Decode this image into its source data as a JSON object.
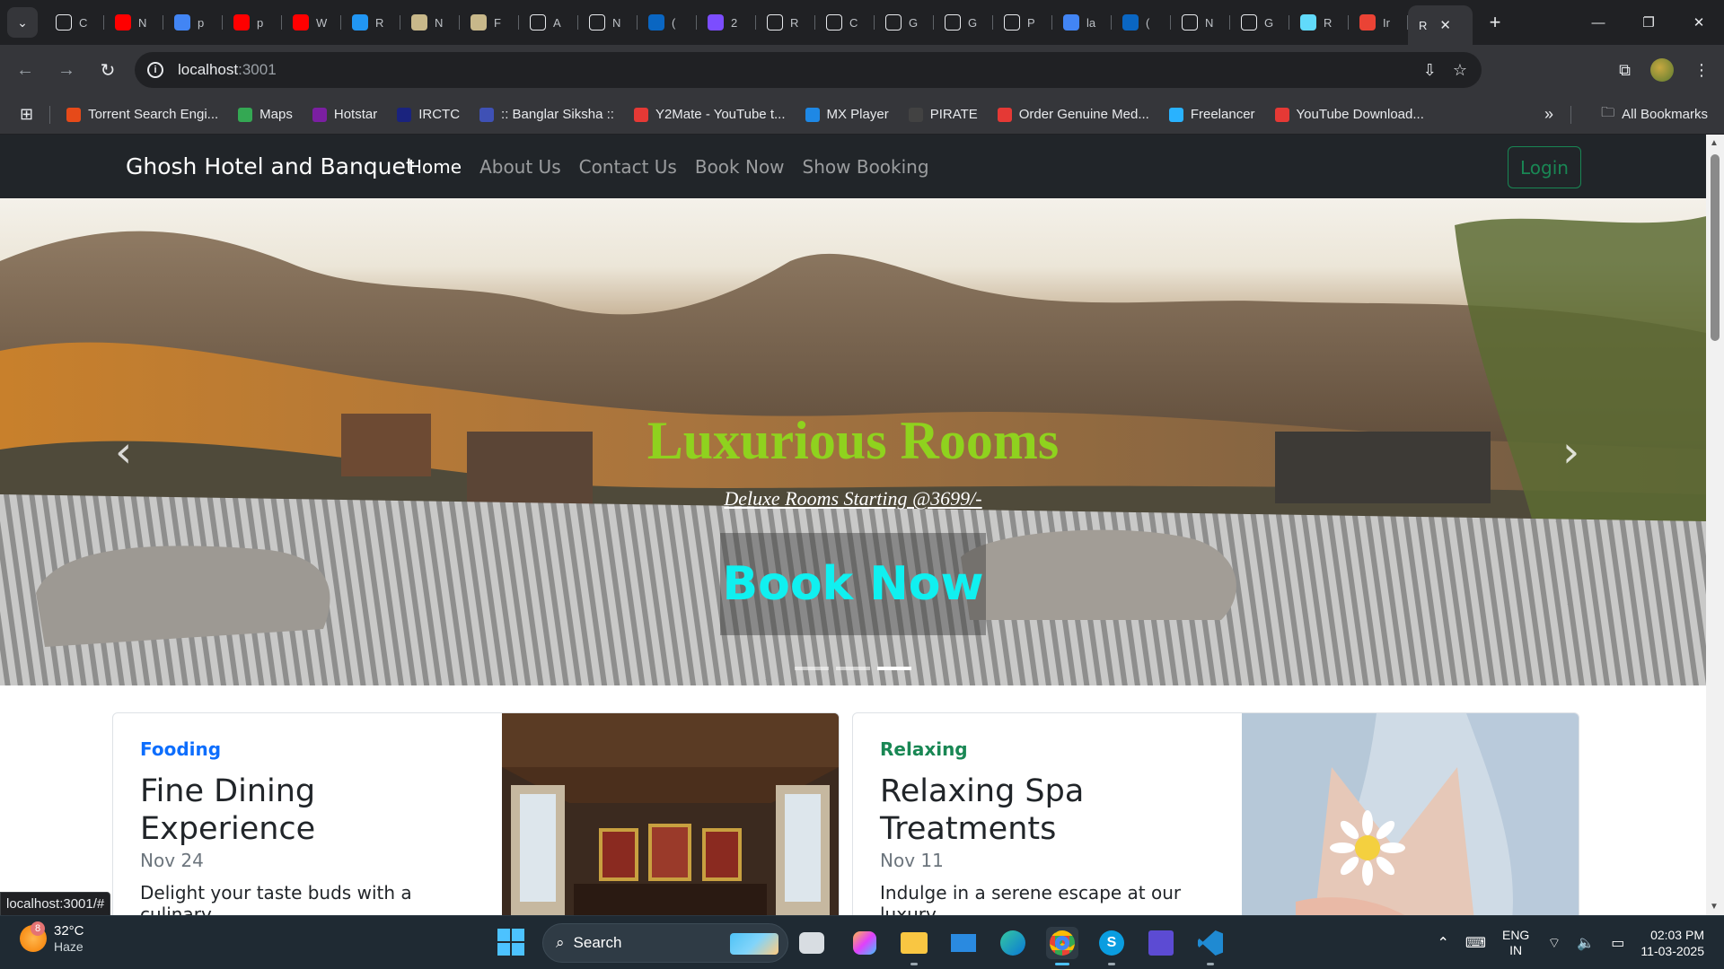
{
  "browser": {
    "tabs": [
      {
        "icon": "triangle-icon",
        "title": "C",
        "color": "#ffffff"
      },
      {
        "icon": "youtube-icon",
        "title": "N",
        "color": "#ff0000"
      },
      {
        "icon": "google-icon",
        "title": "p",
        "color": "#4285f4"
      },
      {
        "icon": "youtube-icon",
        "title": "p",
        "color": "#ff0000"
      },
      {
        "icon": "youtube-icon",
        "title": "W",
        "color": "#ff0000"
      },
      {
        "icon": "react-icon",
        "title": "R",
        "color": "#2196f3"
      },
      {
        "icon": "card-icon",
        "title": "N",
        "color": "#c8b88a"
      },
      {
        "icon": "card-icon",
        "title": "F",
        "color": "#c8b88a"
      },
      {
        "icon": "openai-icon",
        "title": "A",
        "color": "#ffffff"
      },
      {
        "icon": "openai-icon",
        "title": "N",
        "color": "#ffffff"
      },
      {
        "icon": "linkedin-icon",
        "title": "(",
        "color": "#0a66c2"
      },
      {
        "icon": "hash-icon",
        "title": "2",
        "color": "#7c4dff"
      },
      {
        "icon": "person-icon",
        "title": "R",
        "color": "#ffffff"
      },
      {
        "icon": "triangle-icon",
        "title": "C",
        "color": "#ffffff"
      },
      {
        "icon": "github-icon",
        "title": "G",
        "color": "#ffffff"
      },
      {
        "icon": "github-icon",
        "title": "G",
        "color": "#ffffff"
      },
      {
        "icon": "github-icon",
        "title": "P",
        "color": "#ffffff"
      },
      {
        "icon": "google-icon",
        "title": "la",
        "color": "#4285f4"
      },
      {
        "icon": "linkedin-icon",
        "title": "(",
        "color": "#0a66c2"
      },
      {
        "icon": "triangle-icon",
        "title": "N",
        "color": "#ffffff"
      },
      {
        "icon": "github-icon",
        "title": "G",
        "color": "#ffffff"
      },
      {
        "icon": "react-icon",
        "title": "R",
        "color": "#61dafb"
      },
      {
        "icon": "gmail-icon",
        "title": "Ir",
        "color": "#ea4335"
      }
    ],
    "active_tab": {
      "title": "R"
    },
    "url_host": "localhost",
    "url_port": ":3001",
    "bookmarks": [
      {
        "label": "Torrent Search Engi...",
        "icon": "x-icon",
        "color": "#e64a19"
      },
      {
        "label": "Maps",
        "icon": "maps-pin-icon",
        "color": "#34a853"
      },
      {
        "label": "Hotstar",
        "icon": "hotstar-icon",
        "color": "#7b1fa2"
      },
      {
        "label": "IRCTC",
        "icon": "irctc-icon",
        "color": "#1a237e"
      },
      {
        "label": ":: Banglar Siksha ::",
        "icon": "siksha-icon",
        "color": "#3f51b5"
      },
      {
        "label": "Y2Mate - YouTube t...",
        "icon": "y2mate-icon",
        "color": "#e53935"
      },
      {
        "label": "MX Player",
        "icon": "play-icon",
        "color": "#1e88e5"
      },
      {
        "label": "PIRATE",
        "icon": "shield-icon",
        "color": "#424242"
      },
      {
        "label": "Order Genuine Med...",
        "icon": "pharmacy-icon",
        "color": "#e53935"
      },
      {
        "label": "Freelancer",
        "icon": "freelancer-icon",
        "color": "#29b2fe"
      },
      {
        "label": "YouTube Download...",
        "icon": "download-icon",
        "color": "#e53935"
      }
    ],
    "all_bookmarks": "All Bookmarks",
    "status_url": "localhost:3001/#"
  },
  "site": {
    "brand": "Ghosh Hotel and Banquet",
    "nav": [
      "Home",
      "About Us",
      "Contact Us",
      "Book Now",
      "Show Booking"
    ],
    "login": "Login",
    "hero": {
      "title": "Luxurious Rooms",
      "subtitle": "Deluxe Rooms Starting @3699/-",
      "cta": "Book Now",
      "slide_count": 3,
      "active_slide": 3
    },
    "cards": [
      {
        "category": "Fooding",
        "category_color": "#0d6efd",
        "title": "Fine Dining Experience",
        "date": "Nov 24",
        "desc": "Delight your taste buds with a culinary"
      },
      {
        "category": "Relaxing",
        "category_color": "#198754",
        "title": "Relaxing Spa Treatments",
        "date": "Nov 11",
        "desc": "Indulge in a serene escape at our luxury"
      }
    ]
  },
  "taskbar": {
    "weather_temp": "32°C",
    "weather_cond": "Haze",
    "weather_badge": "8",
    "search_label": "Search",
    "apps": [
      "file-explorer-icon",
      "copilot-icon",
      "folder-icon",
      "mail-icon",
      "edge-icon",
      "chrome-icon",
      "skype-icon",
      "vs-icon",
      "vscode-icon"
    ],
    "lang_top": "ENG",
    "lang_bottom": "IN",
    "time": "02:03 PM",
    "date": "11-03-2025"
  }
}
